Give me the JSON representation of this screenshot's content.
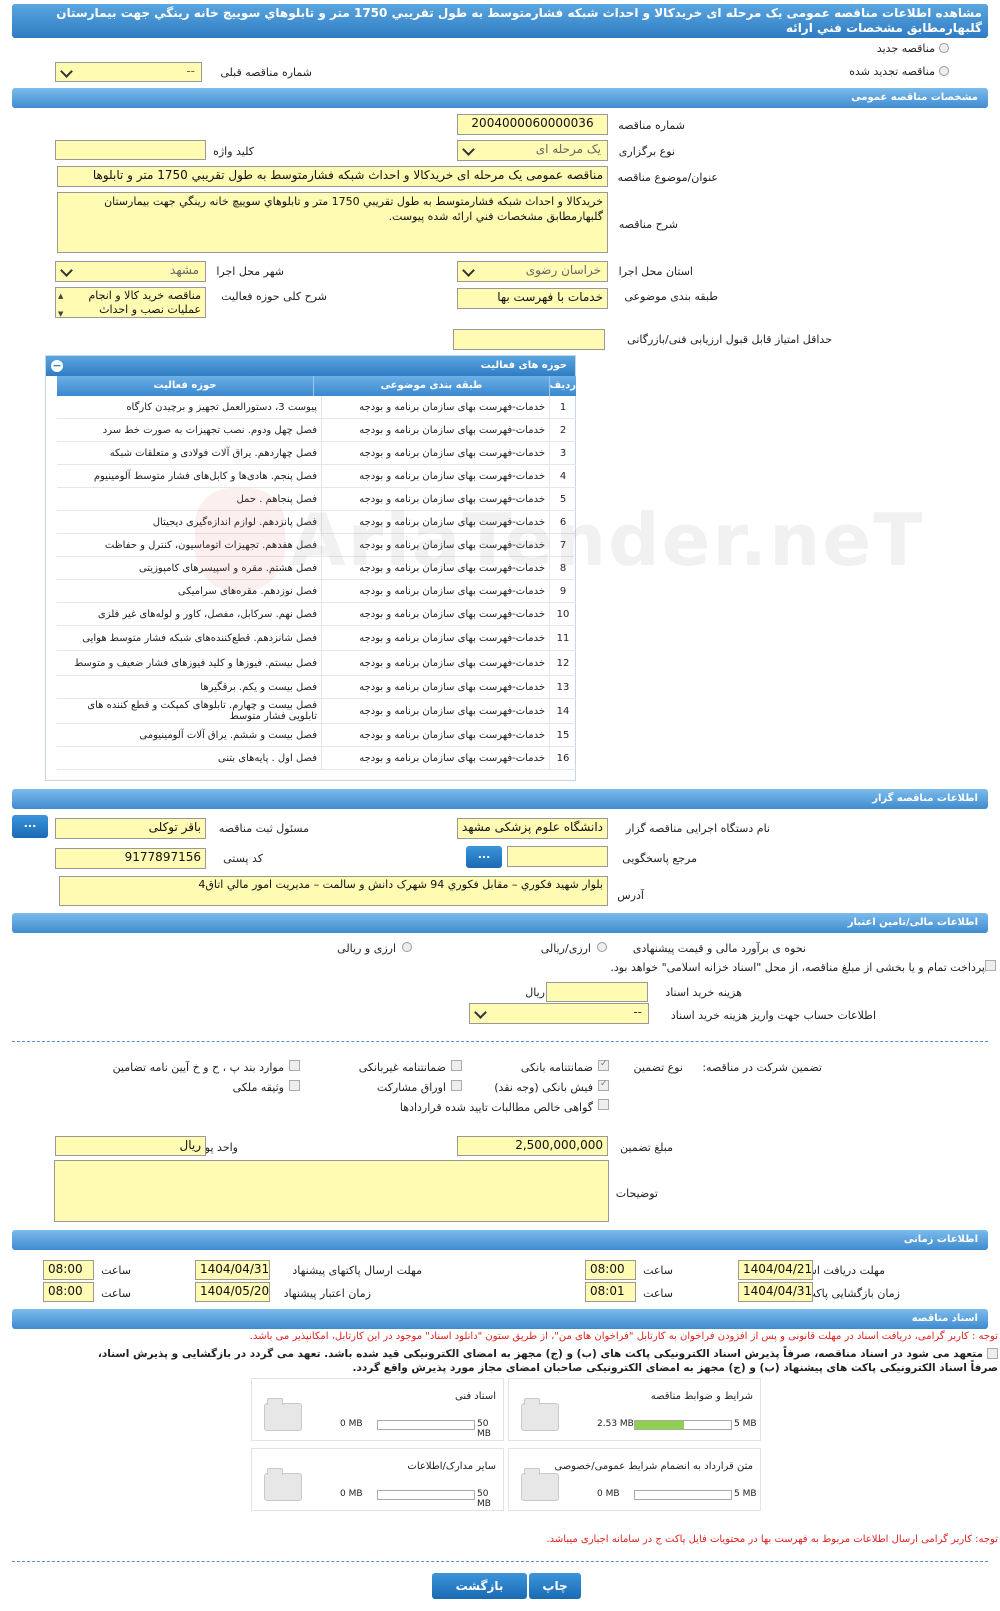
{
  "header": {
    "title": "مشاهده اطلاعات مناقصه عمومی یک مرحله ای خریدکالا و احداث شبکه فشارمتوسط به طول تقریبي 1750 متر و تابلوهاي سوييچ خانه رينگي جهت بيمارستان گلبهارمطابق مشخصات فني ارائه"
  },
  "tender_type": {
    "new_label": "مناقصه جدید",
    "renewed_label": "مناقصه تجدید شده",
    "prev_label": "شماره مناقصه قبلی",
    "prev_value": "--"
  },
  "sections": {
    "general": "مشخصات مناقصه عمومی",
    "organizer": "اطلاعات مناقصه گزار",
    "finance": "اطلاعات مالی/تامین اعتبار",
    "timing": "اطلاعات زمانی",
    "docs": "اسناد مناقصه"
  },
  "general": {
    "number_label": "شماره مناقصه",
    "number_value": "2004000060000036",
    "type_label": "نوع برگزاری",
    "type_value": "یک مرحله ای",
    "keyword_label": "کلید واژه",
    "keyword_value": "",
    "subject_label": "عنوان/موضوع مناقصه",
    "subject_value": "مناقصه عمومی یک مرحله ای خریدکالا و احداث شبکه فشارمتوسط به طول تقریبي 1750 متر و تابلوها",
    "desc_label": "شرح مناقصه",
    "desc_value": "خريدكالا و احداث شبكه فشارمتوسط به طول تقريبي 1750 متر و تابلوهاي سوييچ خانه رينگي جهت بيمارستان گلبهارمطابق مشخصات فني ارائه شده پيوست.",
    "province_label": "استان محل اجرا",
    "province_value": "خراسان رضوی",
    "city_label": "شهر محل اجرا",
    "city_value": "مشهد",
    "category_label": "طبقه بندی موضوعی",
    "category_value": "خدمات با فهرست بها",
    "scope_label": "شرح کلی حوزه فعالیت",
    "scope_value": "مناقصه خرید کالا و انجام عملیات نصب و احداث",
    "min_score_label": "حداقل امتیاز قابل قبول ارزیابی فنی/بازرگانی",
    "min_score_value": ""
  },
  "activity": {
    "title": "حوزه های فعالیت",
    "headers": [
      "ردیف",
      "طبقه بندی موضوعی",
      "حوزه فعالیت"
    ],
    "rows": [
      [
        "1",
        "خدمات-فهرست بهای سازمان برنامه و بودجه",
        "پیوست 3، دستورالعمل تجهیز و برچیدن کارگاه"
      ],
      [
        "2",
        "خدمات-فهرست بهای سازمان برنامه و بودجه",
        "فصل چهل ودوم. نصب تجهیزات به صورت خط سرد"
      ],
      [
        "3",
        "خدمات-فهرست بهای سازمان برنامه و بودجه",
        "فصل چهاردهم. یراق آلات فولادی و متعلقات شبکه"
      ],
      [
        "4",
        "خدمات-فهرست بهای سازمان برنامه و بودجه",
        "فصل پنجم. هادی‌ها و کابل‌های فشار متوسط آلومینیوم"
      ],
      [
        "5",
        "خدمات-فهرست بهای سازمان برنامه و بودجه",
        "فصل پنجاهم . حمل"
      ],
      [
        "6",
        "خدمات-فهرست بهای سازمان برنامه و بودجه",
        "فصل پانزدهم. لوازم اندازه‌گیری دیجیتال"
      ],
      [
        "7",
        "خدمات-فهرست بهای سازمان برنامه و بودجه",
        "فصل هفدهم. تجهیزات اتوماسیون، کنترل و حفاظت"
      ],
      [
        "8",
        "خدمات-فهرست بهای سازمان برنامه و بودجه",
        "فصل هشتم. مقره و اسپیسرهای کامپوزیتی"
      ],
      [
        "9",
        "خدمات-فهرست بهای سازمان برنامه و بودجه",
        "فصل نوزدهم. مقره‌های سرامیکی"
      ],
      [
        "10",
        "خدمات-فهرست بهای سازمان برنامه و بودجه",
        "فصل نهم. سرکابل، مفصل، کاور و لوله‌های غیر فلزی"
      ],
      [
        "11",
        "خدمات-فهرست بهای سازمان برنامه و بودجه",
        "فصل شانزدهم. قطع‌کننده‌های شبکه فشار متوسط هوایی"
      ],
      [
        "12",
        "خدمات-فهرست بهای سازمان برنامه و بودجه",
        "فصل بیستم. فیوزها و کلید فیوزهای فشار ضعیف و متوسط"
      ],
      [
        "13",
        "خدمات-فهرست بهای سازمان برنامه و بودجه",
        "فصل بیست و یکم. برقگیرها"
      ],
      [
        "14",
        "خدمات-فهرست بهای سازمان برنامه و بودجه",
        "فصل بیست و چهارم. تابلوهای کمپکت و قطع کننده های تابلویی فشار متوسط"
      ],
      [
        "15",
        "خدمات-فهرست بهای سازمان برنامه و بودجه",
        "فصل بیست و ششم. یراق آلات آلومینیومی"
      ],
      [
        "16",
        "خدمات-فهرست بهای سازمان برنامه و بودجه",
        "فصل اول . پایه‌های بتنی"
      ]
    ]
  },
  "organizer": {
    "org_label": "نام دستگاه اجرایی مناقصه گزار",
    "org_value": "دانشگاه علوم پزشکی مشهد",
    "officer_label": "مسئول ثبت مناقصه",
    "officer_value": "باقر توکلی",
    "ref_label": "مرجع پاسخگویی",
    "ref_value": "",
    "postal_label": "کد پستی",
    "postal_value": "9177897156",
    "address_label": "آدرس",
    "address_value": "بلوار شهيد فكوري – مقابل فكوري 94 شهرک دانش و سالمت – مديريت امور مالي اتاق4",
    "dots": "..."
  },
  "finance": {
    "estimate_label": "نحوه ی برآورد مالی و قیمت پیشنهادی",
    "rial_label": "ارزی/ریالی",
    "fx_rial_label": "ارزی و ریالی",
    "islamic_label": "پرداخت تمام و یا بخشی از مبلغ مناقصه، از محل \"اسناد خزانه اسلامی\" خواهد بود.",
    "doc_fee_label": "هزینه خرید اسناد",
    "doc_fee_value": "",
    "doc_fee_unit": "ریال",
    "account_label": "اطلاعات حساب جهت واریز هزینه خرید اسناد",
    "account_value": "--",
    "guarantee_label": "تضمین شرکت در مناقصه:",
    "guarantee_type_label": "نوع تضمین",
    "g_bank": "ضمانتنامه بانکی",
    "g_nonbank": "ضمانتنامه غیربانکی",
    "g_rules": "موارد بند پ ، ح و خ آیین نامه تضامین",
    "g_cheque": "فیش بانکی (وجه نقد)",
    "g_bonds": "اوراق مشارکت",
    "g_property": "وثیقه ملکی",
    "g_claims": "گواهی خالص مطالبات تایید شده قراردادها",
    "amount_label": "مبلغ تضمین",
    "amount_value": "2,500,000,000",
    "unit_label": "واحد پول",
    "unit_value": "ریال",
    "notes_label": "توضیحات",
    "notes_value": ""
  },
  "timing": {
    "receive_label": "مهلت دریافت اسناد",
    "receive_date": "1404/04/21",
    "receive_time": "08:00",
    "send_label": "مهلت ارسال پاکتهای پیشنهاد",
    "send_date": "1404/04/31",
    "send_time": "08:00",
    "open_label": "زمان بازگشایی پاکت ها",
    "open_date": "1404/04/31",
    "open_time": "08:01",
    "validity_label": "زمان اعتبار پیشنهاد",
    "validity_date": "1404/05/20",
    "validity_time": "08:00",
    "time_label": "ساعت"
  },
  "docs": {
    "note1": "توجه : کاربر گرامی، دریافت اسناد در مهلت قانونی و پس از افزودن فراخوان به کارتابل \"فراخوان های من\"، از طریق ستون \"دانلود اسناد\" موجود در این کارتابل، امکانپذیر می باشد.",
    "commit_line1": "متعهد می شود در اسناد مناقصه، صرفاً پذیرش اسناد الکترونیکی پاکت های (ب) و (ج) مجهز به امضای الکترونیکی قید شده باشد. تعهد می گردد در بازگشایی و پذیرش اسناد،",
    "commit_line2": "صرفاً اسناد الکترونیکی پاکت های پیشنهاد (ب) و (ج) مجهز به امضای الکترونیکی صاحبان امضای مجاز مورد پذیرش واقع گردد.",
    "note2": "توجه: کاربر گرامی ارسال اطلاعات مربوط به فهرست بها در محتویات فایل پاکت ج در سامانه اجباری میباشد.",
    "files": [
      {
        "name": "شرایط و ضوابط مناقصه",
        "used": "2.53 MB",
        "max": "5 MB",
        "fill": 0.506
      },
      {
        "name": "اسناد فنی",
        "used": "0 MB",
        "max": "50 MB",
        "fill": 0
      },
      {
        "name": "متن قرارداد به انضمام شرایط عمومی/خصوصی",
        "used": "0 MB",
        "max": "5 MB",
        "fill": 0
      },
      {
        "name": "سایر مدارک/اطلاعات",
        "used": "0 MB",
        "max": "50 MB",
        "fill": 0
      }
    ]
  },
  "footer": {
    "print": "چاپ",
    "back": "بازگشت"
  },
  "watermark": "AriaTender.neT"
}
